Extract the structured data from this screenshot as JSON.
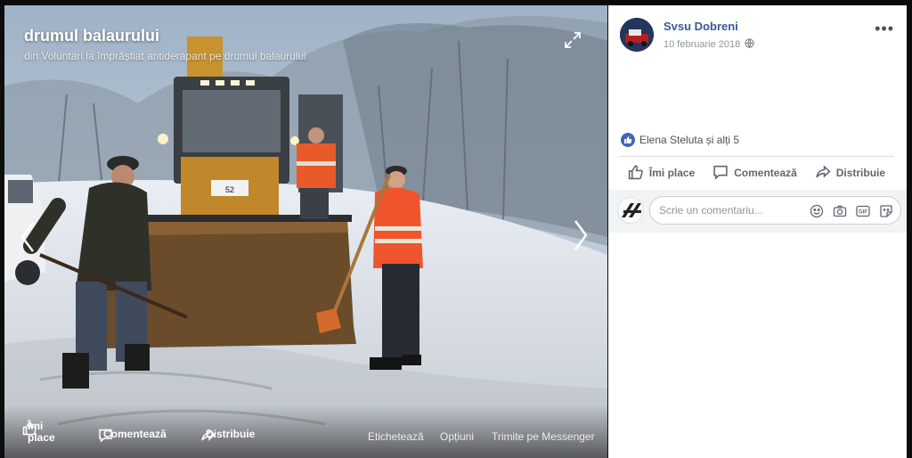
{
  "photo": {
    "title": "drumul balaurului",
    "subtitle": "din Voluntari la împrăștiat antiderapant pe drumul balaurului",
    "plate": "52",
    "bottom_actions": {
      "like": "Îmi place",
      "like_line1": "Îmi",
      "like_line2": "place",
      "comment": "Comentează",
      "share": "Distribuie"
    },
    "right_links": {
      "tag": "Etichetează",
      "options": "Opțiuni",
      "messenger": "Trimite pe Messenger"
    }
  },
  "post": {
    "author": "Svsu Dobreni",
    "date": "10 februarie 2018",
    "privacy_icon": "globe-icon",
    "more_icon": "more-icon",
    "more_label": "•••",
    "reactions_text": "Elena Steluta și alți 5",
    "actions": {
      "like": "Îmi place",
      "comment": "Comentează",
      "share": "Distribuie"
    },
    "comment_placeholder": "Scrie un comentariu...",
    "comment_icons": [
      "emoji-icon",
      "camera-icon",
      "gif-icon",
      "sticker-icon"
    ]
  },
  "colors": {
    "accent": "#4267b2",
    "link": "#385898",
    "muted": "#90949c",
    "panel_bg": "#ffffff"
  }
}
